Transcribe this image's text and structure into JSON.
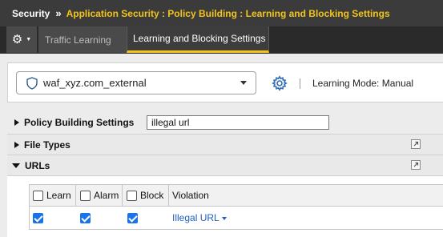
{
  "breadcrumb": {
    "root": "Security",
    "separator": "»",
    "path": "Application Security : Policy Building : Learning and Blocking Settings"
  },
  "tabs": {
    "gear_icon": "gear-icon",
    "traffic_learning": "Traffic Learning",
    "learning_blocking": "Learning and Blocking Settings"
  },
  "policy": {
    "selected": "waf_xyz.com_external",
    "icon": "shield-icon",
    "learning_mode_label": "Learning Mode:",
    "learning_mode_value": "Manual"
  },
  "policy_building_settings": {
    "label": "Policy Building Settings",
    "search_value": "illegal url"
  },
  "sections": {
    "file_types": "File Types",
    "urls": "URLs"
  },
  "urls_table": {
    "headers": {
      "learn": "Learn",
      "alarm": "Alarm",
      "block": "Block",
      "violation": "Violation"
    },
    "rows": [
      {
        "learn": true,
        "alarm": true,
        "block": true,
        "violation": "Illegal URL"
      }
    ]
  },
  "colors": {
    "accent": "#f3c41a",
    "link": "#2060c0",
    "checkbox": "#1a73e8"
  }
}
